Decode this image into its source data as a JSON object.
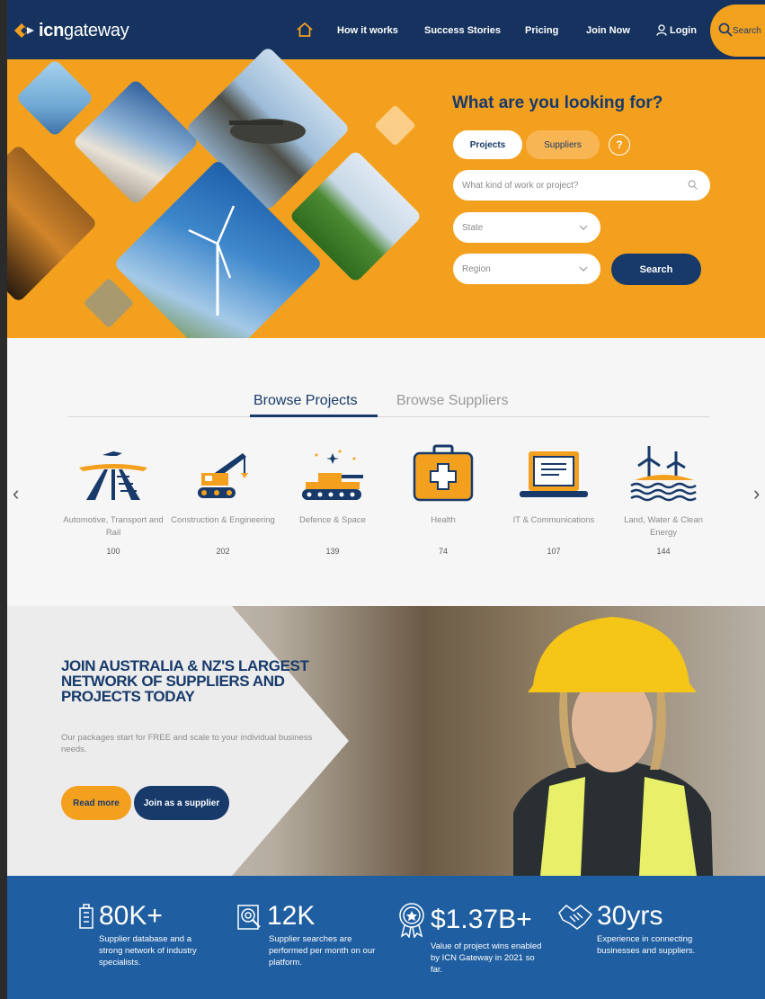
{
  "nav": {
    "logo_bold": "icn",
    "logo_light": "gateway",
    "items": [
      "How it works",
      "Success Stories",
      "Pricing",
      "Join Now"
    ],
    "login": "Login",
    "search": "Search"
  },
  "hero": {
    "title": "What are you looking for?",
    "toggle_projects": "Projects",
    "toggle_suppliers": "Suppliers",
    "help": "?",
    "work_placeholder": "What kind of work or project?",
    "state_placeholder": "State",
    "region_placeholder": "Region",
    "search_button": "Search"
  },
  "browse": {
    "tab_projects": "Browse Projects",
    "tab_suppliers": "Browse Suppliers",
    "categories": [
      {
        "label": "Automotive, Transport and Rail",
        "count": "100",
        "icon": "rail-icon"
      },
      {
        "label": "Construction & Engineering",
        "count": "202",
        "icon": "crane-icon"
      },
      {
        "label": "Defence & Space",
        "count": "139",
        "icon": "tank-icon"
      },
      {
        "label": "Health",
        "count": "74",
        "icon": "medical-kit-icon"
      },
      {
        "label": "IT & Communications",
        "count": "107",
        "icon": "laptop-icon"
      },
      {
        "label": "Land, Water & Clean Energy",
        "count": "144",
        "icon": "wind-turbine-icon"
      }
    ],
    "prev": "‹",
    "next": "›"
  },
  "join": {
    "title": "JOIN AUSTRALIA & NZ'S LARGEST NETWORK OF SUPPLIERS AND PROJECTS TODAY",
    "text": "Our packages start for FREE and scale to your individual business needs.",
    "read_more": "Read more",
    "join_supplier": "Join as a supplier"
  },
  "stats": [
    {
      "num": "80K+",
      "desc": "Supplier database and a strong network of industry specialists.",
      "icon": "building-icon"
    },
    {
      "num": "12K",
      "desc": "Supplier searches are performed per month on our platform.",
      "icon": "search-document-icon"
    },
    {
      "num": "$1.37B+",
      "desc": "Value of project wins enabled by ICN Gateway in 2021 so far.",
      "icon": "award-icon"
    },
    {
      "num": "30yrs",
      "desc": "Experience in connecting businesses and suppliers.",
      "icon": "handshake-icon"
    }
  ],
  "colors": {
    "navy": "#16335f",
    "orange": "#f4a01f",
    "blue": "#1f5ea1"
  }
}
